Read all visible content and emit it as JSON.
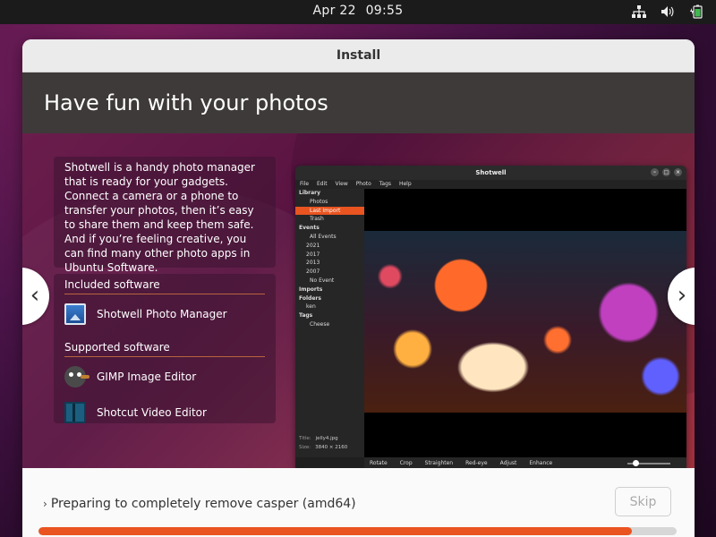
{
  "topbar": {
    "date": "Apr 22",
    "time": "09:55",
    "icons": [
      "network-icon",
      "volume-icon",
      "battery-charging-icon"
    ]
  },
  "window": {
    "title": "Install"
  },
  "slide": {
    "heading": "Have fun with your photos",
    "description": "Shotwell is a handy photo manager that is ready for your gadgets. Connect a camera or a phone to transfer your photos, then it’s easy to share them and keep them safe. And if you’re feeling creative, you can find many other photo apps in Ubuntu Software.",
    "included_title": "Included software",
    "included": [
      {
        "label": "Shotwell Photo Manager",
        "icon": "shotwell-icon"
      }
    ],
    "supported_title": "Supported software",
    "supported": [
      {
        "label": "GIMP Image Editor",
        "icon": "gimp-icon"
      },
      {
        "label": "Shotcut Video Editor",
        "icon": "shotcut-icon"
      }
    ],
    "prev_arrow": "‹",
    "next_arrow": "›"
  },
  "shotwell": {
    "title": "Shotwell",
    "menu": [
      "File",
      "Edit",
      "View",
      "Photo",
      "Tags",
      "Help"
    ],
    "sidebar": {
      "library": "Library",
      "photos": "Photos",
      "last_import": "Last Import",
      "trash": "Trash",
      "events": "Events",
      "all_events": "All Events",
      "y2021": "2021",
      "y2017": "2017",
      "y2013": "2013",
      "y2007": "2007",
      "no_event": "No Event",
      "imports": "Imports",
      "folders": "Folders",
      "ken": "ken",
      "tags": "Tags",
      "cheese": "Cheese"
    },
    "meta": {
      "title_label": "Title:",
      "title_value": "jelly4.jpg",
      "size_label": "Size:",
      "size_value": "3840 × 2160"
    },
    "tools": [
      "Rotate",
      "Crop",
      "Straighten",
      "Red-eye",
      "Adjust",
      "Enhance"
    ]
  },
  "footer": {
    "status": "Preparing to completely remove casper (amd64)",
    "skip_label": "Skip",
    "progress_fraction": 0.93,
    "accent": "#e95420"
  }
}
